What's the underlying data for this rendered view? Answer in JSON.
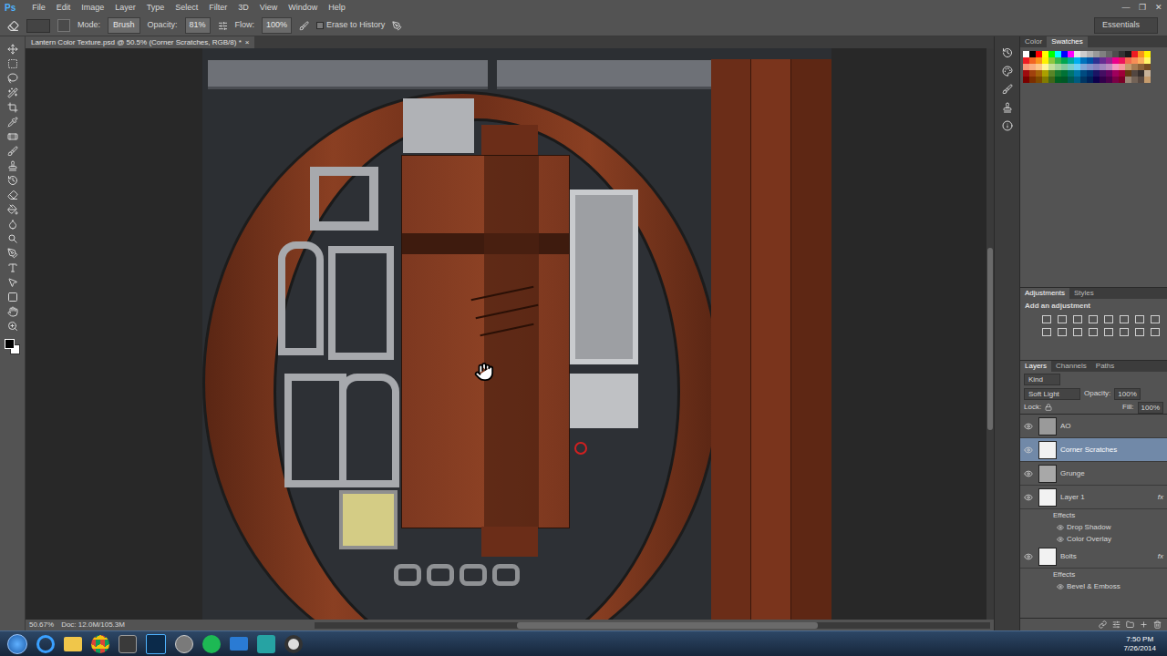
{
  "app": {
    "logo": "Ps",
    "menus": [
      "File",
      "Edit",
      "Image",
      "Layer",
      "Type",
      "Select",
      "Filter",
      "3D",
      "View",
      "Window",
      "Help"
    ],
    "window_controls": [
      "—",
      "❐",
      "✕"
    ]
  },
  "options_bar": {
    "mode_label": "Mode:",
    "mode": "Brush",
    "opacity_label": "Opacity:",
    "opacity": "81%",
    "flow_label": "Flow:",
    "flow": "100%",
    "erase_to_history": {
      "label": "Erase to History",
      "checked": false
    },
    "workspace": "Essentials"
  },
  "document": {
    "title": "Lantern Color Texture.psd @ 50.5% (Corner Scratches, RGB/8) *",
    "close": "×",
    "zoom": "50.67%",
    "doc_size": "Doc: 12.0M/105.3M",
    "vscroll": {
      "level": 0.35
    },
    "hscroll": {
      "level": 0.3
    }
  },
  "color_panel": {
    "tabs": [
      {
        "label": "Color",
        "selected": false
      },
      {
        "label": "Swatches",
        "selected": true
      }
    ],
    "swatches": [
      "#ffffff",
      "#000000",
      "#ff0000",
      "#ffff00",
      "#00ff00",
      "#00ffff",
      "#0000ff",
      "#ff00ff",
      "#e6e6e6",
      "#cccccc",
      "#b3b3b3",
      "#999999",
      "#808080",
      "#666666",
      "#4d4d4d",
      "#333333",
      "#1a1a1a",
      "#ed1c24",
      "#f7941d",
      "#fff200",
      "#ed1c24",
      "#f26522",
      "#f7941d",
      "#fff200",
      "#8dc63f",
      "#39b54a",
      "#00a651",
      "#00a99d",
      "#00aeef",
      "#0072bc",
      "#0054a6",
      "#2e3192",
      "#662d91",
      "#92278f",
      "#ec008c",
      "#ed145b",
      "#f26c4f",
      "#f68e56",
      "#fbaf5d",
      "#fff568",
      "#f7977a",
      "#f9ad81",
      "#fdc68a",
      "#fff79a",
      "#c4df9b",
      "#a3d39c",
      "#82ca9d",
      "#7bcdc8",
      "#6ecff6",
      "#7ea7d8",
      "#8493ca",
      "#8882be",
      "#a187be",
      "#bc8dbf",
      "#f49ac2",
      "#f6989d",
      "#c69c6d",
      "#a67c52",
      "#8c6239",
      "#754c24",
      "#9e0b0f",
      "#a0410d",
      "#a36209",
      "#aba000",
      "#598527",
      "#1a7b30",
      "#007236",
      "#00746b",
      "#0076a3",
      "#004b80",
      "#003471",
      "#1b1464",
      "#440e62",
      "#630460",
      "#9e005d",
      "#9e0039",
      "#603913",
      "#534741",
      "#362f2d",
      "#c7b299",
      "#790000",
      "#7b2e00",
      "#7d4900",
      "#827b00",
      "#406618",
      "#005e20",
      "#005826",
      "#005952",
      "#005b7f",
      "#003663",
      "#002157",
      "#0d004c",
      "#32004b",
      "#4b0049",
      "#7b0046",
      "#7a0026",
      "#998675",
      "#736357",
      "#594a42",
      "#c69c6d"
    ]
  },
  "adjustments_panel": {
    "tabs": [
      {
        "label": "Adjustments",
        "selected": true
      },
      {
        "label": "Styles",
        "selected": false
      }
    ],
    "hint": "Add an adjustment"
  },
  "layers_panel": {
    "tabs": [
      {
        "label": "Layers",
        "selected": true
      },
      {
        "label": "Channels",
        "selected": false
      },
      {
        "label": "Paths",
        "selected": false
      }
    ],
    "filter": "Kind",
    "blend_mode": "Soft Light",
    "opacity_label": "Opacity:",
    "opacity": "100%",
    "lock_label": "Lock:",
    "fill_label": "Fill:",
    "fill": "100%",
    "layers": [
      {
        "name": "AO",
        "visible": true,
        "selected": false,
        "color": "#9a9a9a",
        "fx": false,
        "effects_label": "",
        "effects": []
      },
      {
        "name": "Corner Scratches",
        "visible": true,
        "selected": true,
        "color": "#f2f2f2",
        "fx": false,
        "effects_label": "",
        "effects": []
      },
      {
        "name": "Grunge",
        "visible": true,
        "selected": false,
        "color": "#a8a8a8",
        "fx": false,
        "effects_label": "",
        "effects": []
      },
      {
        "name": "Layer 1",
        "visible": true,
        "selected": false,
        "color": "#f2f2f2",
        "fx": true,
        "effects_label": "Effects",
        "effects": [
          "Drop Shadow",
          "Color Overlay"
        ]
      },
      {
        "name": "Bolts",
        "visible": true,
        "selected": false,
        "color": "#f2f2f2",
        "fx": true,
        "effects_label": "Effects",
        "effects": [
          "Bevel & Emboss"
        ]
      }
    ]
  },
  "taskbar": {
    "time": "7:50 PM",
    "date": "7/26/2014"
  }
}
